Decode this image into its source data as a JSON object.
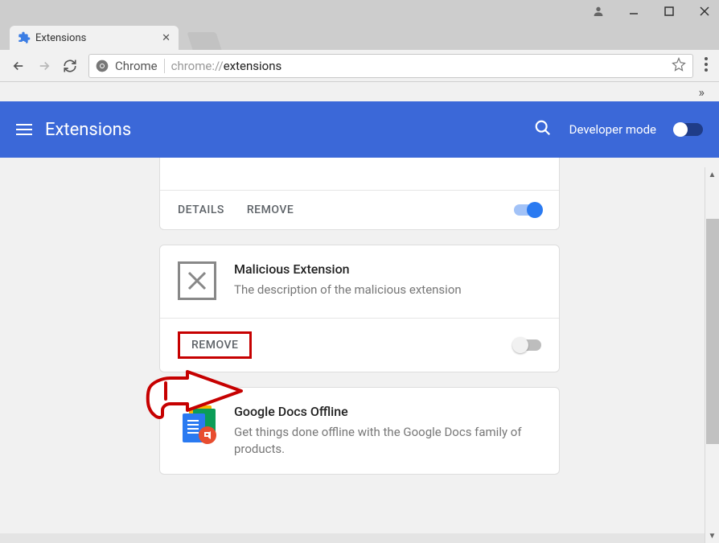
{
  "window": {
    "tab_title": "Extensions"
  },
  "omnibox": {
    "protocol_label": "Chrome",
    "url_prefix": "chrome://",
    "url_path": "extensions"
  },
  "header": {
    "title": "Extensions",
    "dev_mode_label": "Developer mode"
  },
  "card1": {
    "details_label": "DETAILS",
    "remove_label": "REMOVE"
  },
  "card2": {
    "title": "Malicious Extension",
    "description": "The description of the malicious extension",
    "remove_label": "REMOVE"
  },
  "card3": {
    "title": "Google Docs Offline",
    "description": "Get things done offline with the Google Docs family of products."
  }
}
